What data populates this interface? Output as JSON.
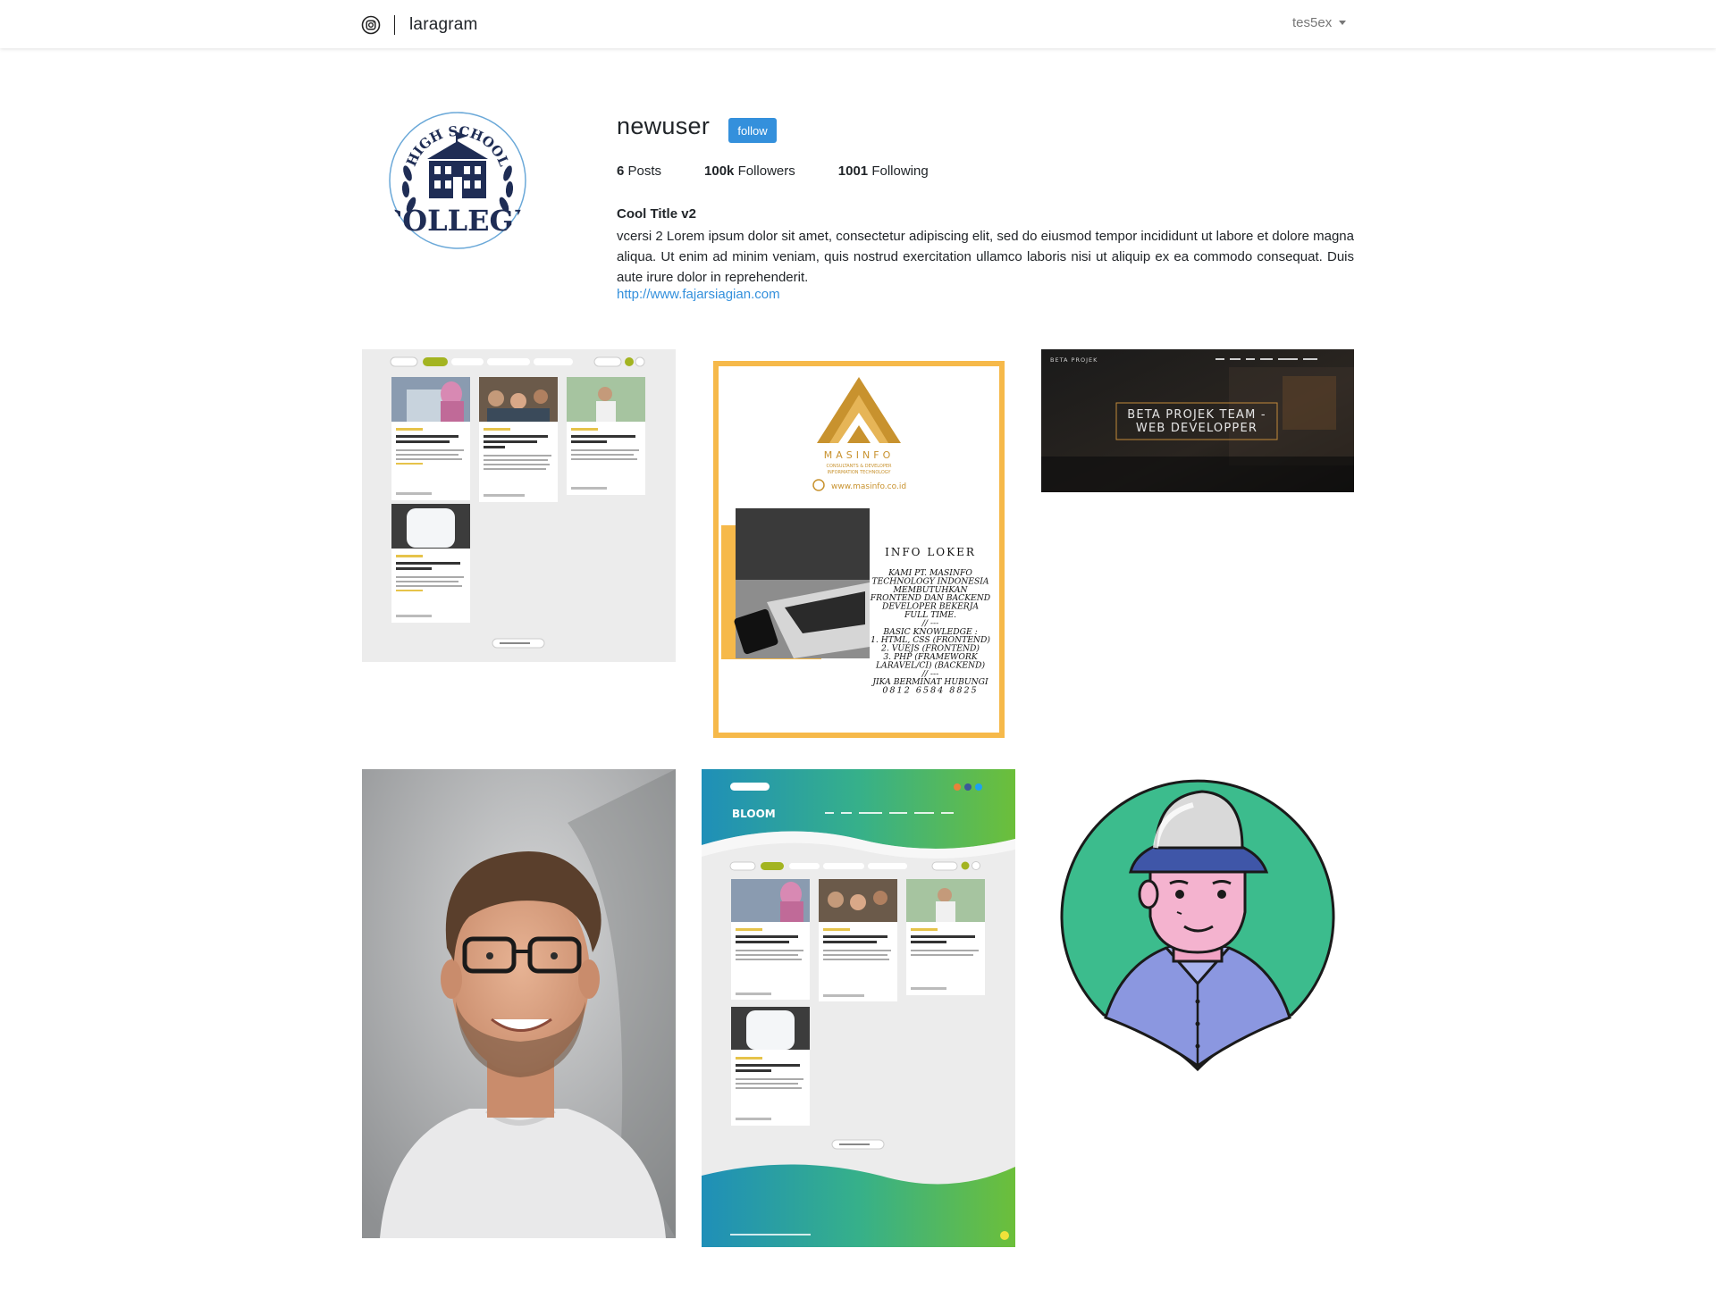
{
  "navbar": {
    "brand": "laragram",
    "icon": "instagram-icon",
    "user": "tes5ex"
  },
  "profile": {
    "username": "newuser",
    "follow_label": "follow",
    "posts_count": "6",
    "posts_label": "Posts",
    "followers_count": "100k",
    "followers_label": "Followers",
    "following_count": "1001",
    "following_label": "Following",
    "title": "Cool Title v2",
    "description": "vcersi 2 Lorem ipsum dolor sit amet, consectetur adipiscing elit, sed do eiusmod tempor incididunt ut labore et dolore magna aliqua. Ut enim ad minim veniam, quis nostrud exercitation ullamco laboris nisi ut aliquip ex ea commodo consequat. Duis aute irure dolor in reprehenderit.",
    "url": "http://www.fajarsiagian.com",
    "avatar": {
      "top_text": "HIGH SCHOOL",
      "bottom_text": "COLLEGE"
    }
  },
  "posts": {
    "p2": {
      "brand": "MASINFO",
      "tagline": "CONSULTANTS & DEVELOPER",
      "tagline2": "INFORMATION TECHNOLOGY",
      "website": "www.masinfo.co.id",
      "heading": "INFO LOKER",
      "lines": [
        "KAMI PT. MASINFO",
        "TECHNOLOGY INDONESIA",
        "MEMBUTUHKAN",
        "FRONTEND DAN BACKEND",
        "DEVELOPER BEKERJA",
        "FULL TIME.",
        "// ---",
        "BASIC KNOWLEDGE :",
        "1. HTML, CSS (FRONTEND)",
        "2. VUEJS (FRONTEND)",
        "3. PHP (FRAMEWORK",
        "LARAVEL/CI) (BACKEND)",
        "// ---",
        "JIKA BERMINAT HUBUNGI",
        "0812 6584 8825"
      ]
    },
    "p3": {
      "site": "BETA PROJEK",
      "line1": "BETA PROJEK TEAM -",
      "line2": "WEB DEVELOPPER"
    }
  },
  "colors": {
    "accent": "#3490dc",
    "masinfo_gold": "#f6b94a",
    "avatar_green": "#3cbc8d"
  }
}
